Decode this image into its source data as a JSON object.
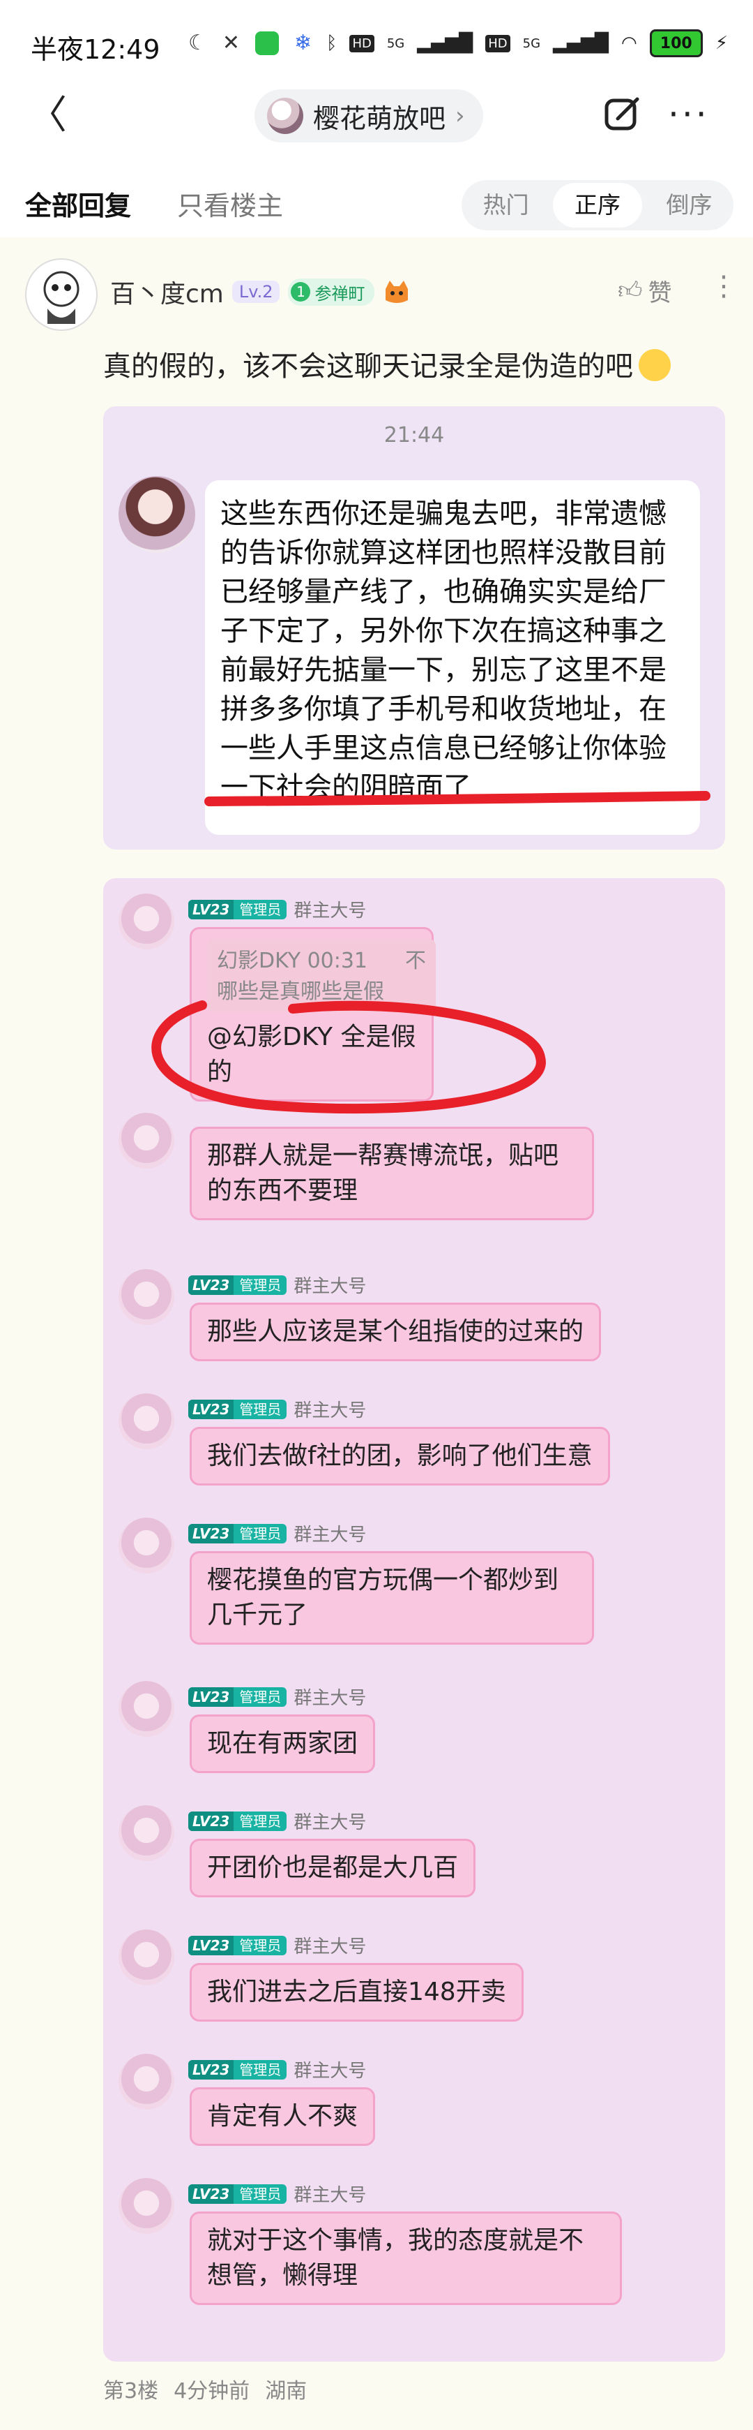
{
  "status_bar": {
    "time": "半夜12:49",
    "network_1": "HD",
    "gen_1": "5G",
    "network_2": "HD",
    "gen_2": "5G",
    "battery": "100",
    "icons": [
      "moon-icon",
      "mute-icon",
      "wechat-icon",
      "snowflake-icon",
      "bluetooth-icon",
      "signal-icon",
      "wifi-icon",
      "charging-icon"
    ]
  },
  "nav": {
    "back": "〈",
    "forum_name": "樱花萌放吧",
    "chevron": "›",
    "more": "···"
  },
  "filters": {
    "all": "全部回复",
    "host_only": "只看楼主",
    "sort": [
      "热门",
      "正序",
      "倒序"
    ],
    "sort_active": "正序"
  },
  "post": {
    "username": "百丶度cm",
    "level": "Lv.2",
    "title_badge_num": "1",
    "title_badge": "参禅町",
    "like": "赞",
    "text": "真的假的，该不会这聊天记录全是伪造的吧",
    "floor": "第3楼",
    "time_ago": "4分钟前",
    "location": "湖南"
  },
  "screenshot1": {
    "timestamp": "21:44",
    "message": "这些东西你还是骗鬼去吧，非常遗憾的告诉你就算这样团也照样没散目前已经够量产线了，也确确实实是给厂子下定了，另外你下次在搞这种事之前最好先掂量一下，别忘了这里不是拼多多你填了手机号和收货地址，在一些人手里这点信息已经够让你体验一下社会的阴暗面了"
  },
  "screenshot2": {
    "lv": "LV23",
    "role": "管理员",
    "group": "群主大号",
    "quote_head": "幻影DKY 00:31",
    "quote_right": "不",
    "quote_body": "哪些是真哪些是假",
    "messages": [
      "@幻影DKY 全是假的",
      "那群人就是一帮赛博流氓，贴吧的东西不要理",
      "那些人应该是某个组指使的过来的",
      "我们去做f社的团，影响了他们生意",
      "樱花摸鱼的官方玩偶一个都炒到几千元了",
      "现在有两家团",
      "开团价也是都是大几百",
      "我们进去之后直接148开卖",
      "肯定有人不爽",
      "就对于这个事情，我的态度就是不想管，懒得理"
    ]
  },
  "colors": {
    "annotation_red": "#e8202a",
    "bubble_pink": "#f9c7e0",
    "admin_teal": "#18b3a3"
  }
}
